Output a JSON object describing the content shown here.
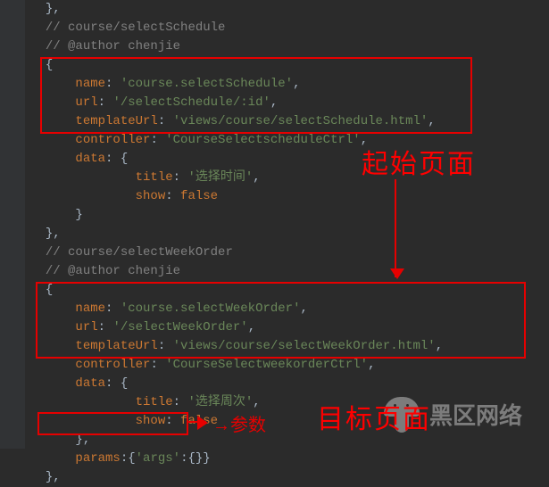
{
  "annotations": {
    "label_start_page": "起始页面",
    "label_target_page": "目标页面",
    "label_params": "参数",
    "arrow_right_glyph": "→"
  },
  "watermark": {
    "text": "黑区网络"
  },
  "code_lines": [
    {
      "indent": 1,
      "tokens": [
        {
          "t": "},",
          "c": "brace"
        }
      ]
    },
    {
      "indent": 1,
      "tokens": [
        {
          "t": "// course/selectSchedule",
          "c": "comment"
        }
      ]
    },
    {
      "indent": 1,
      "tokens": [
        {
          "t": "// @author chenjie",
          "c": "comment"
        }
      ]
    },
    {
      "indent": 1,
      "tokens": [
        {
          "t": "{",
          "c": "brace"
        }
      ]
    },
    {
      "indent": 2,
      "tokens": [
        {
          "t": "name",
          "c": "key"
        },
        {
          "t": ": ",
          "c": "punct"
        },
        {
          "t": "'course.selectSchedule'",
          "c": "string"
        },
        {
          "t": ",",
          "c": "punct"
        }
      ]
    },
    {
      "indent": 2,
      "tokens": [
        {
          "t": "url",
          "c": "key"
        },
        {
          "t": ": ",
          "c": "punct"
        },
        {
          "t": "'/selectSchedule/:id'",
          "c": "string"
        },
        {
          "t": ",",
          "c": "punct"
        }
      ]
    },
    {
      "indent": 2,
      "tokens": [
        {
          "t": "templateUrl",
          "c": "key"
        },
        {
          "t": ": ",
          "c": "punct"
        },
        {
          "t": "'views/course/selectSchedule.html'",
          "c": "string"
        },
        {
          "t": ",",
          "c": "punct"
        }
      ]
    },
    {
      "indent": 2,
      "tokens": [
        {
          "t": "controller",
          "c": "key"
        },
        {
          "t": ": ",
          "c": "punct"
        },
        {
          "t": "'CourseSelectscheduleCtrl'",
          "c": "string"
        },
        {
          "t": ",",
          "c": "punct"
        }
      ]
    },
    {
      "indent": 2,
      "tokens": [
        {
          "t": "data",
          "c": "key"
        },
        {
          "t": ": {",
          "c": "punct"
        }
      ]
    },
    {
      "indent": 4,
      "tokens": [
        {
          "t": "title",
          "c": "key"
        },
        {
          "t": ": ",
          "c": "punct"
        },
        {
          "t": "'选择时间'",
          "c": "string"
        },
        {
          "t": ",",
          "c": "punct"
        }
      ]
    },
    {
      "indent": 4,
      "tokens": [
        {
          "t": "show",
          "c": "key"
        },
        {
          "t": ": ",
          "c": "punct"
        },
        {
          "t": "false",
          "c": "boolean"
        }
      ]
    },
    {
      "indent": 2,
      "tokens": [
        {
          "t": "}",
          "c": "brace"
        }
      ]
    },
    {
      "indent": 1,
      "tokens": [
        {
          "t": "},",
          "c": "brace"
        }
      ]
    },
    {
      "indent": 1,
      "tokens": [
        {
          "t": "// course/selectWeekOrder",
          "c": "comment"
        }
      ]
    },
    {
      "indent": 1,
      "tokens": [
        {
          "t": "// @author chenjie",
          "c": "comment"
        }
      ]
    },
    {
      "indent": 1,
      "tokens": [
        {
          "t": "{",
          "c": "brace"
        }
      ]
    },
    {
      "indent": 2,
      "tokens": [
        {
          "t": "name",
          "c": "key"
        },
        {
          "t": ": ",
          "c": "punct"
        },
        {
          "t": "'course.selectWeekOrder'",
          "c": "string"
        },
        {
          "t": ",",
          "c": "punct"
        }
      ]
    },
    {
      "indent": 2,
      "tokens": [
        {
          "t": "url",
          "c": "key"
        },
        {
          "t": ": ",
          "c": "punct"
        },
        {
          "t": "'/selectWeekOrder'",
          "c": "string"
        },
        {
          "t": ",",
          "c": "punct"
        }
      ]
    },
    {
      "indent": 2,
      "tokens": [
        {
          "t": "templateUrl",
          "c": "key"
        },
        {
          "t": ": ",
          "c": "punct"
        },
        {
          "t": "'views/course/selectWeekOrder.html'",
          "c": "string"
        },
        {
          "t": ",",
          "c": "punct"
        }
      ]
    },
    {
      "indent": 2,
      "tokens": [
        {
          "t": "controller",
          "c": "key"
        },
        {
          "t": ": ",
          "c": "punct"
        },
        {
          "t": "'CourseSelectweekorderCtrl'",
          "c": "string"
        },
        {
          "t": ",",
          "c": "punct"
        }
      ]
    },
    {
      "indent": 2,
      "tokens": [
        {
          "t": "data",
          "c": "key"
        },
        {
          "t": ": {",
          "c": "punct"
        }
      ]
    },
    {
      "indent": 4,
      "tokens": [
        {
          "t": "title",
          "c": "key"
        },
        {
          "t": ": ",
          "c": "punct"
        },
        {
          "t": "'选择周次'",
          "c": "string"
        },
        {
          "t": ",",
          "c": "punct"
        }
      ]
    },
    {
      "indent": 4,
      "tokens": [
        {
          "t": "show",
          "c": "key"
        },
        {
          "t": ": ",
          "c": "punct"
        },
        {
          "t": "false",
          "c": "boolean"
        }
      ]
    },
    {
      "indent": 2,
      "tokens": [
        {
          "t": "},",
          "c": "brace"
        }
      ]
    },
    {
      "indent": 2,
      "tokens": [
        {
          "t": "params",
          "c": "key"
        },
        {
          "t": ":{",
          "c": "punct"
        },
        {
          "t": "'args'",
          "c": "string"
        },
        {
          "t": ":{}}",
          "c": "punct"
        }
      ]
    },
    {
      "indent": 1,
      "tokens": [
        {
          "t": "},",
          "c": "brace"
        }
      ]
    }
  ]
}
